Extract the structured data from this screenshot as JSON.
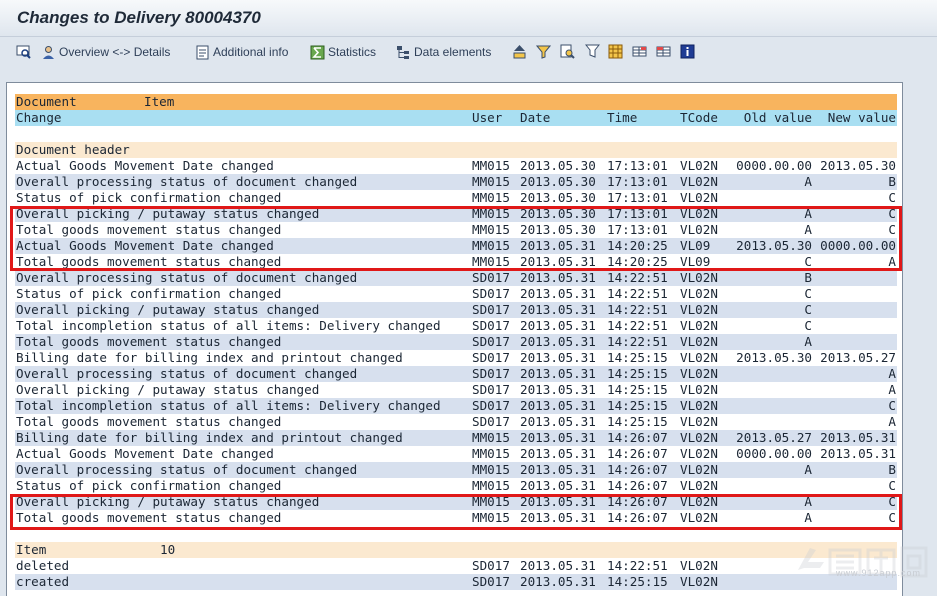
{
  "window": {
    "title": "Changes to Delivery 80004370"
  },
  "toolbar": {
    "overview_label": "Overview <-> Details",
    "additional_label": "Additional info",
    "statistics_label": "Statistics",
    "data_elements_label": "Data elements"
  },
  "report": {
    "header1": {
      "document": "Document",
      "item": "Item"
    },
    "header2": {
      "change": "Change",
      "user": "User",
      "date": "Date",
      "time": "Time",
      "tcode": "TCode",
      "old": "Old value",
      "new": "New value"
    },
    "doc_section": "Document header",
    "rows": [
      {
        "change": "Actual Goods Movement Date changed",
        "user": "MM015",
        "date": "2013.05.30",
        "time": "17:13:01",
        "tcode": "VL02N",
        "old": "0000.00.00",
        "new": "2013.05.30"
      },
      {
        "change": "Overall processing status of document changed",
        "user": "MM015",
        "date": "2013.05.30",
        "time": "17:13:01",
        "tcode": "VL02N",
        "old": "A",
        "new": "B"
      },
      {
        "change": "Status of pick confirmation changed",
        "user": "MM015",
        "date": "2013.05.30",
        "time": "17:13:01",
        "tcode": "VL02N",
        "old": "",
        "new": "C"
      },
      {
        "change": "Overall picking / putaway status changed",
        "user": "MM015",
        "date": "2013.05.30",
        "time": "17:13:01",
        "tcode": "VL02N",
        "old": "A",
        "new": "C"
      },
      {
        "change": "Total goods movement status changed",
        "user": "MM015",
        "date": "2013.05.30",
        "time": "17:13:01",
        "tcode": "VL02N",
        "old": "A",
        "new": "C"
      },
      {
        "change": "Actual Goods Movement Date changed",
        "user": "MM015",
        "date": "2013.05.31",
        "time": "14:20:25",
        "tcode": "VL09",
        "old": "2013.05.30",
        "new": "0000.00.00"
      },
      {
        "change": "Total goods movement status changed",
        "user": "MM015",
        "date": "2013.05.31",
        "time": "14:20:25",
        "tcode": "VL09",
        "old": "C",
        "new": "A"
      },
      {
        "change": "Overall processing status of document changed",
        "user": "SD017",
        "date": "2013.05.31",
        "time": "14:22:51",
        "tcode": "VL02N",
        "old": "B",
        "new": ""
      },
      {
        "change": "Status of pick confirmation changed",
        "user": "SD017",
        "date": "2013.05.31",
        "time": "14:22:51",
        "tcode": "VL02N",
        "old": "C",
        "new": ""
      },
      {
        "change": "Overall picking / putaway status changed",
        "user": "SD017",
        "date": "2013.05.31",
        "time": "14:22:51",
        "tcode": "VL02N",
        "old": "C",
        "new": ""
      },
      {
        "change": "Total incompletion status of all items: Delivery changed",
        "user": "SD017",
        "date": "2013.05.31",
        "time": "14:22:51",
        "tcode": "VL02N",
        "old": "C",
        "new": ""
      },
      {
        "change": "Total goods movement status changed",
        "user": "SD017",
        "date": "2013.05.31",
        "time": "14:22:51",
        "tcode": "VL02N",
        "old": "A",
        "new": ""
      },
      {
        "change": "Billing date for billing index and printout changed",
        "user": "SD017",
        "date": "2013.05.31",
        "time": "14:25:15",
        "tcode": "VL02N",
        "old": "2013.05.30",
        "new": "2013.05.27"
      },
      {
        "change": "Overall processing status of document changed",
        "user": "SD017",
        "date": "2013.05.31",
        "time": "14:25:15",
        "tcode": "VL02N",
        "old": "",
        "new": "A"
      },
      {
        "change": "Overall picking / putaway status changed",
        "user": "SD017",
        "date": "2013.05.31",
        "time": "14:25:15",
        "tcode": "VL02N",
        "old": "",
        "new": "A"
      },
      {
        "change": "Total incompletion status of all items: Delivery changed",
        "user": "SD017",
        "date": "2013.05.31",
        "time": "14:25:15",
        "tcode": "VL02N",
        "old": "",
        "new": "C"
      },
      {
        "change": "Total goods movement status changed",
        "user": "SD017",
        "date": "2013.05.31",
        "time": "14:25:15",
        "tcode": "VL02N",
        "old": "",
        "new": "A"
      },
      {
        "change": "Billing date for billing index and printout changed",
        "user": "MM015",
        "date": "2013.05.31",
        "time": "14:26:07",
        "tcode": "VL02N",
        "old": "2013.05.27",
        "new": "2013.05.31"
      },
      {
        "change": "Actual Goods Movement Date changed",
        "user": "MM015",
        "date": "2013.05.31",
        "time": "14:26:07",
        "tcode": "VL02N",
        "old": "0000.00.00",
        "new": "2013.05.31"
      },
      {
        "change": "Overall processing status of document changed",
        "user": "MM015",
        "date": "2013.05.31",
        "time": "14:26:07",
        "tcode": "VL02N",
        "old": "A",
        "new": "B"
      },
      {
        "change": "Status of pick confirmation changed",
        "user": "MM015",
        "date": "2013.05.31",
        "time": "14:26:07",
        "tcode": "VL02N",
        "old": "",
        "new": "C"
      },
      {
        "change": "Overall picking / putaway status changed",
        "user": "MM015",
        "date": "2013.05.31",
        "time": "14:26:07",
        "tcode": "VL02N",
        "old": "A",
        "new": "C"
      },
      {
        "change": "Total goods movement status changed",
        "user": "MM015",
        "date": "2013.05.31",
        "time": "14:26:07",
        "tcode": "VL02N",
        "old": "A",
        "new": "C"
      }
    ],
    "item_section": {
      "label": "Item",
      "value": "10"
    },
    "item_rows": [
      {
        "change": "deleted",
        "user": "SD017",
        "date": "2013.05.31",
        "time": "14:22:51",
        "tcode": "VL02N",
        "old": "",
        "new": ""
      },
      {
        "change": "created",
        "user": "SD017",
        "date": "2013.05.31",
        "time": "14:25:15",
        "tcode": "VL02N",
        "old": "",
        "new": ""
      }
    ]
  },
  "watermark": {
    "text": "www.912app.com"
  },
  "colors": {
    "header_orange": "#f8b45e",
    "header_blue": "#a9dff2",
    "section_beige": "#fbe9d0",
    "row_alt": "#d7e0ee",
    "highlight_red": "#e01818"
  }
}
